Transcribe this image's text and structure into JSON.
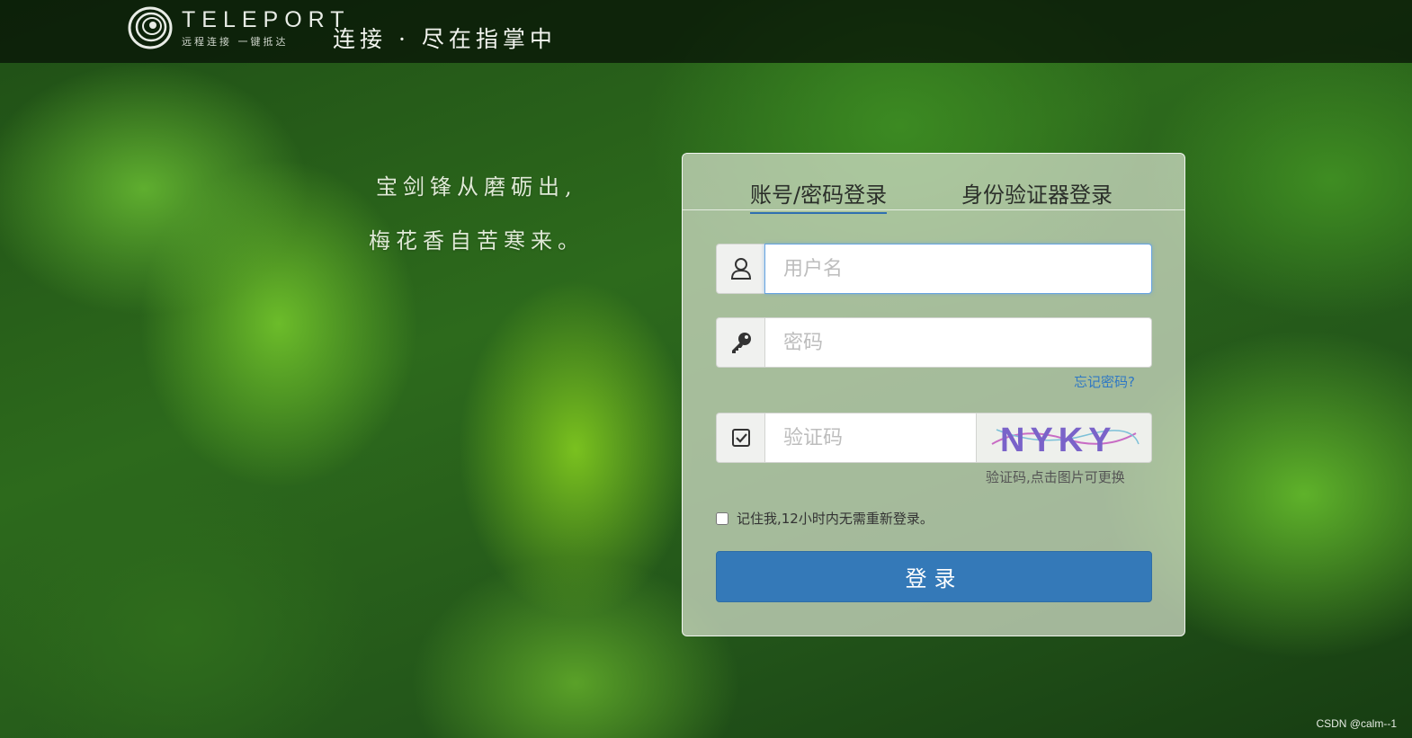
{
  "header": {
    "brand": "TELEPORT",
    "brand_subtitle": "远程连接 一键抵达",
    "slogan": "连接 · 尽在指掌中"
  },
  "poem": {
    "line1": "宝剑锋从磨砺出,",
    "line2": "梅花香自苦寒来。"
  },
  "login": {
    "tabs": [
      {
        "label": "账号/密码登录",
        "active": true
      },
      {
        "label": "身份验证器登录",
        "active": false
      }
    ],
    "username": {
      "placeholder": "用户名",
      "value": "",
      "icon": "user-icon"
    },
    "password": {
      "placeholder": "密码",
      "value": "",
      "icon": "key-icon"
    },
    "forgot_label": "忘记密码?",
    "captcha": {
      "placeholder": "验证码",
      "value": "",
      "icon": "checkbox-icon",
      "image_text": "NYKY"
    },
    "captcha_hint": "验证码,点击图片可更换",
    "remember_label": "记住我,12小时内无需重新登录。",
    "remember_checked": false,
    "submit_label": "登录"
  },
  "watermark": "CSDN @calm--1",
  "colors": {
    "primary": "#3479b8",
    "link": "#2f78c4",
    "tab_underline": "#2f6fb0"
  }
}
